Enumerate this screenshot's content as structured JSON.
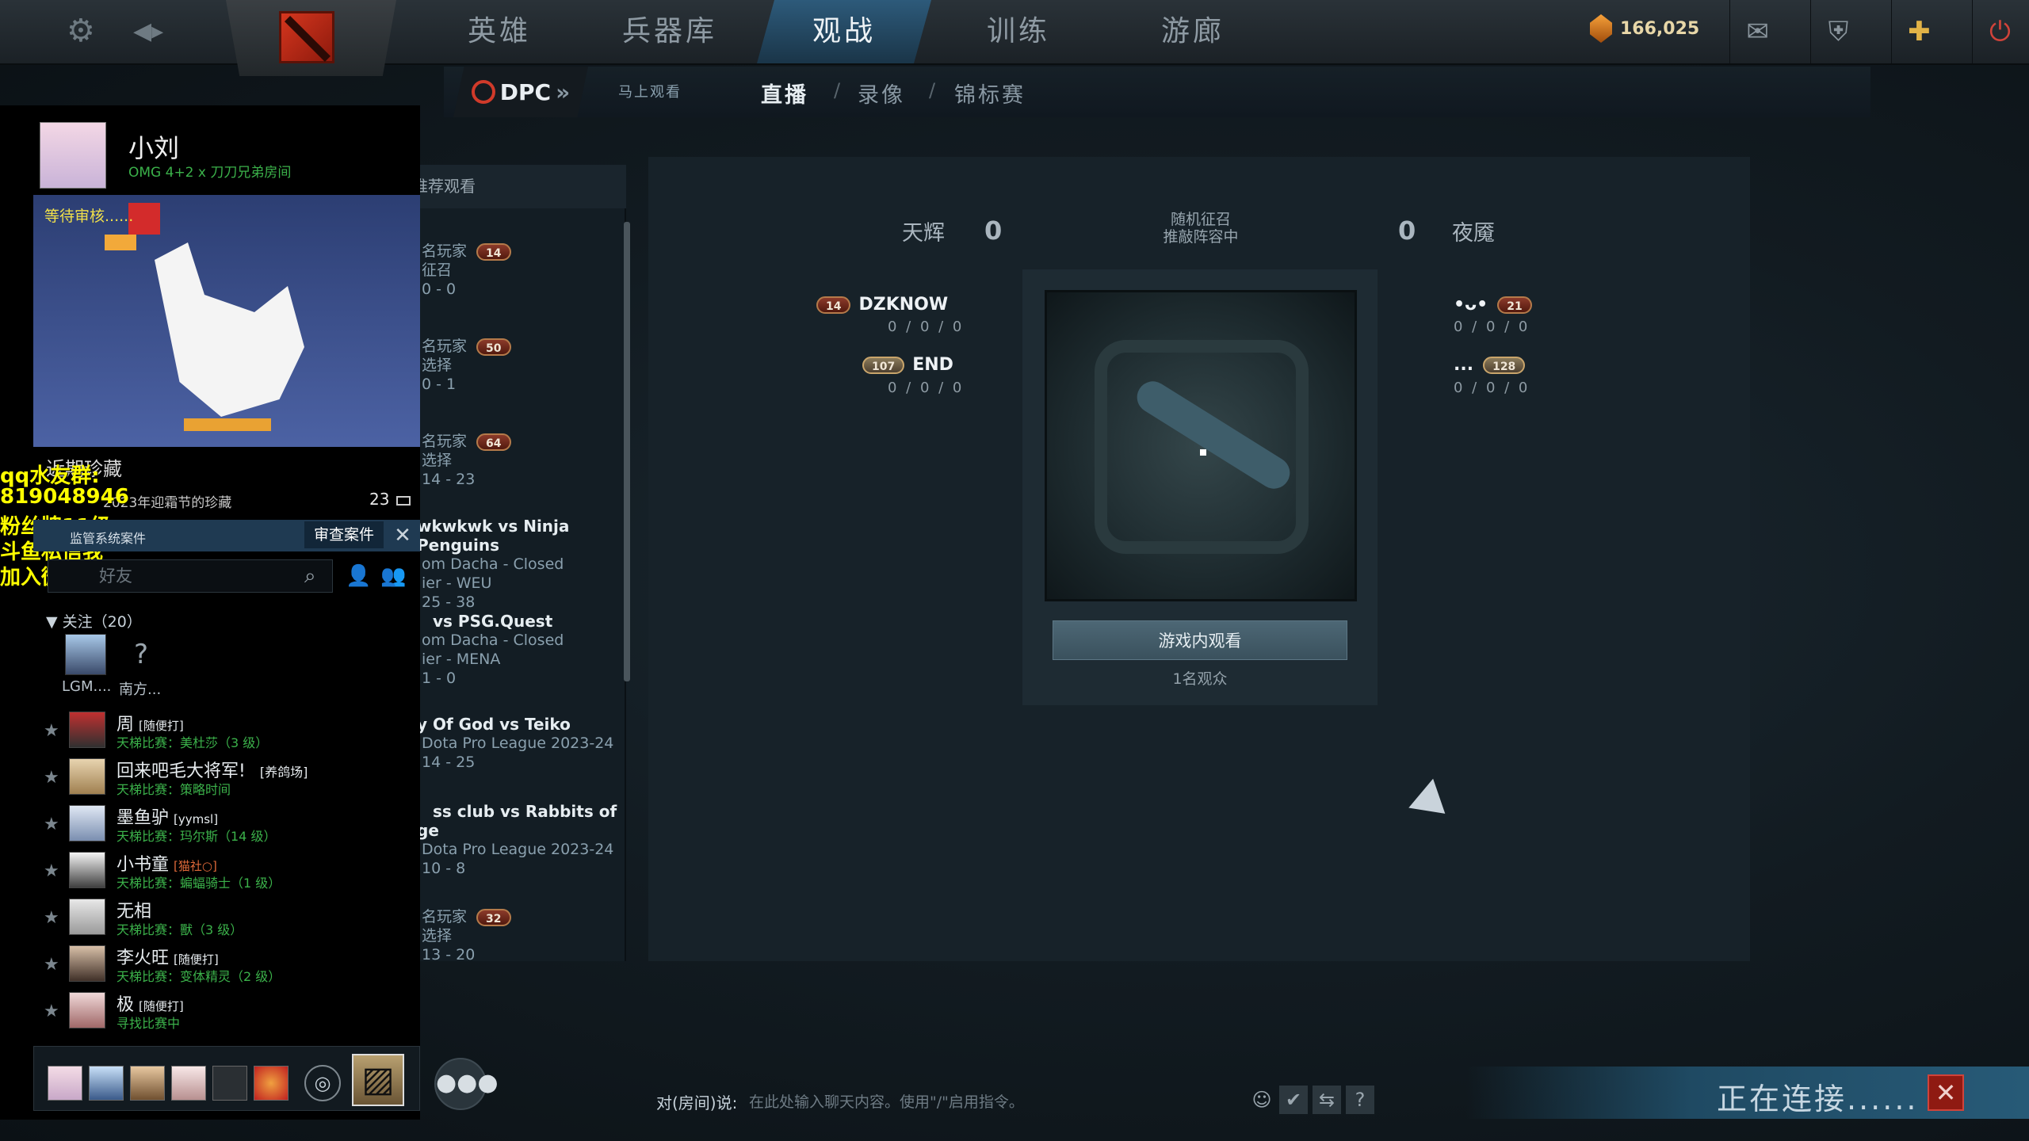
{
  "topbar": {
    "nav_tabs": [
      "英雄",
      "兵器库",
      "观战",
      "训练",
      "游廊"
    ],
    "active_tab": "观战",
    "shards": "166,025"
  },
  "subbar": {
    "dpc": "DPC",
    "watch_now": "马上观看",
    "tabs": [
      "直播",
      "录像",
      "锦标赛"
    ],
    "active": "直播"
  },
  "match_list": {
    "header": "推荐观看",
    "items": [
      {
        "line1": "名玩家",
        "badge": "14",
        "line2": "征召",
        "line3": "0 - 0"
      },
      {
        "line1": "名玩家",
        "badge": "50",
        "line2": "选择",
        "line3": "0 - 1"
      },
      {
        "line1": "名玩家",
        "badge": "64",
        "line2": "选择",
        "line3": "14 - 23"
      },
      {
        "title": "wkwkwk vs Ninja Penguins",
        "line2": "om Dacha - Closed",
        "line3": "ier - WEU",
        "line4": "25 - 38"
      },
      {
        "title": "vs PSG.Quest",
        "line2": "om Dacha - Closed",
        "line3": "ier - MENA",
        "line4": "1 - 0"
      },
      {
        "title": "y Of God vs Teiko",
        "line2": "Dota Pro League  2023-24",
        "line3": "14 - 25"
      },
      {
        "title": "ss club vs Rabbits of",
        "line2": "ge",
        "line3": "Dota Pro League  2023-24",
        "line4": "10 - 8"
      },
      {
        "line1": "名玩家",
        "badge": "32",
        "line2": "选择",
        "line3": "13 - 20"
      }
    ]
  },
  "match": {
    "radiant": "天辉",
    "radiant_score": "0",
    "dire": "夜魇",
    "dire_score": "0",
    "mode_line1": "随机征召",
    "mode_line2": "推敲阵容中",
    "radiant_players": [
      {
        "badge": "14",
        "name": "DZKNOW",
        "kda": "0 / 0 / 0"
      },
      {
        "badge": "107",
        "name": "END",
        "kda": "0 / 0 / 0"
      }
    ],
    "dire_players": [
      {
        "name": "•ᴗ•",
        "badge": "21",
        "kda": "0 / 0 / 0"
      },
      {
        "name": "...",
        "badge": "128",
        "kda": "0 / 0 / 0"
      }
    ],
    "watch_button": "游戏内观看",
    "viewers": "1名观众"
  },
  "overlay": {
    "user_name": "小刘",
    "user_sub": "OMG 4+2 x 刀刀兄弟房间",
    "pending": "等待审核......",
    "collection_title": "近期珍藏",
    "collection_sub": "2023年迎霜节的珍藏",
    "collection_count": "23",
    "stream_lines": [
      "qq水友群:",
      "819048946",
      "粉丝牌11级",
      "斗鱼私信我",
      "加入微信群"
    ],
    "case_title": "监管系统案件",
    "case_button": "审查案件",
    "search_placeholder": "好友",
    "follow_header": "关注（20）",
    "favorites": [
      "LGM....",
      "南方..."
    ],
    "friends": [
      {
        "name": "周",
        "tag": "[随便打]",
        "status": "天梯比赛：美杜莎（3 级）"
      },
      {
        "name": "回来吧毛大将军!",
        "tag": "[养鸽场]",
        "status": "天梯比赛：策略时间"
      },
      {
        "name": "墨鱼驴",
        "tag": "[yymsl]",
        "status": "天梯比赛：玛尔斯（14 级）"
      },
      {
        "name": "小书童",
        "tag": "[猫社○]",
        "status": "天梯比赛：蝙蝠骑士（1 级）"
      },
      {
        "name": "无相",
        "tag": "",
        "status": "天梯比赛：獸（3 级）"
      },
      {
        "name": "李火旺",
        "tag": "[随便打]",
        "status": "天梯比赛：变体精灵（2 级）"
      },
      {
        "name": "极",
        "tag": "[随便打]",
        "status": "寻找比赛中"
      }
    ]
  },
  "chat": {
    "label": "对(房间)说:",
    "placeholder": "在此处输入聊天内容。使用\"/\"启用指令。"
  },
  "status": {
    "connecting": "正在连接......"
  }
}
